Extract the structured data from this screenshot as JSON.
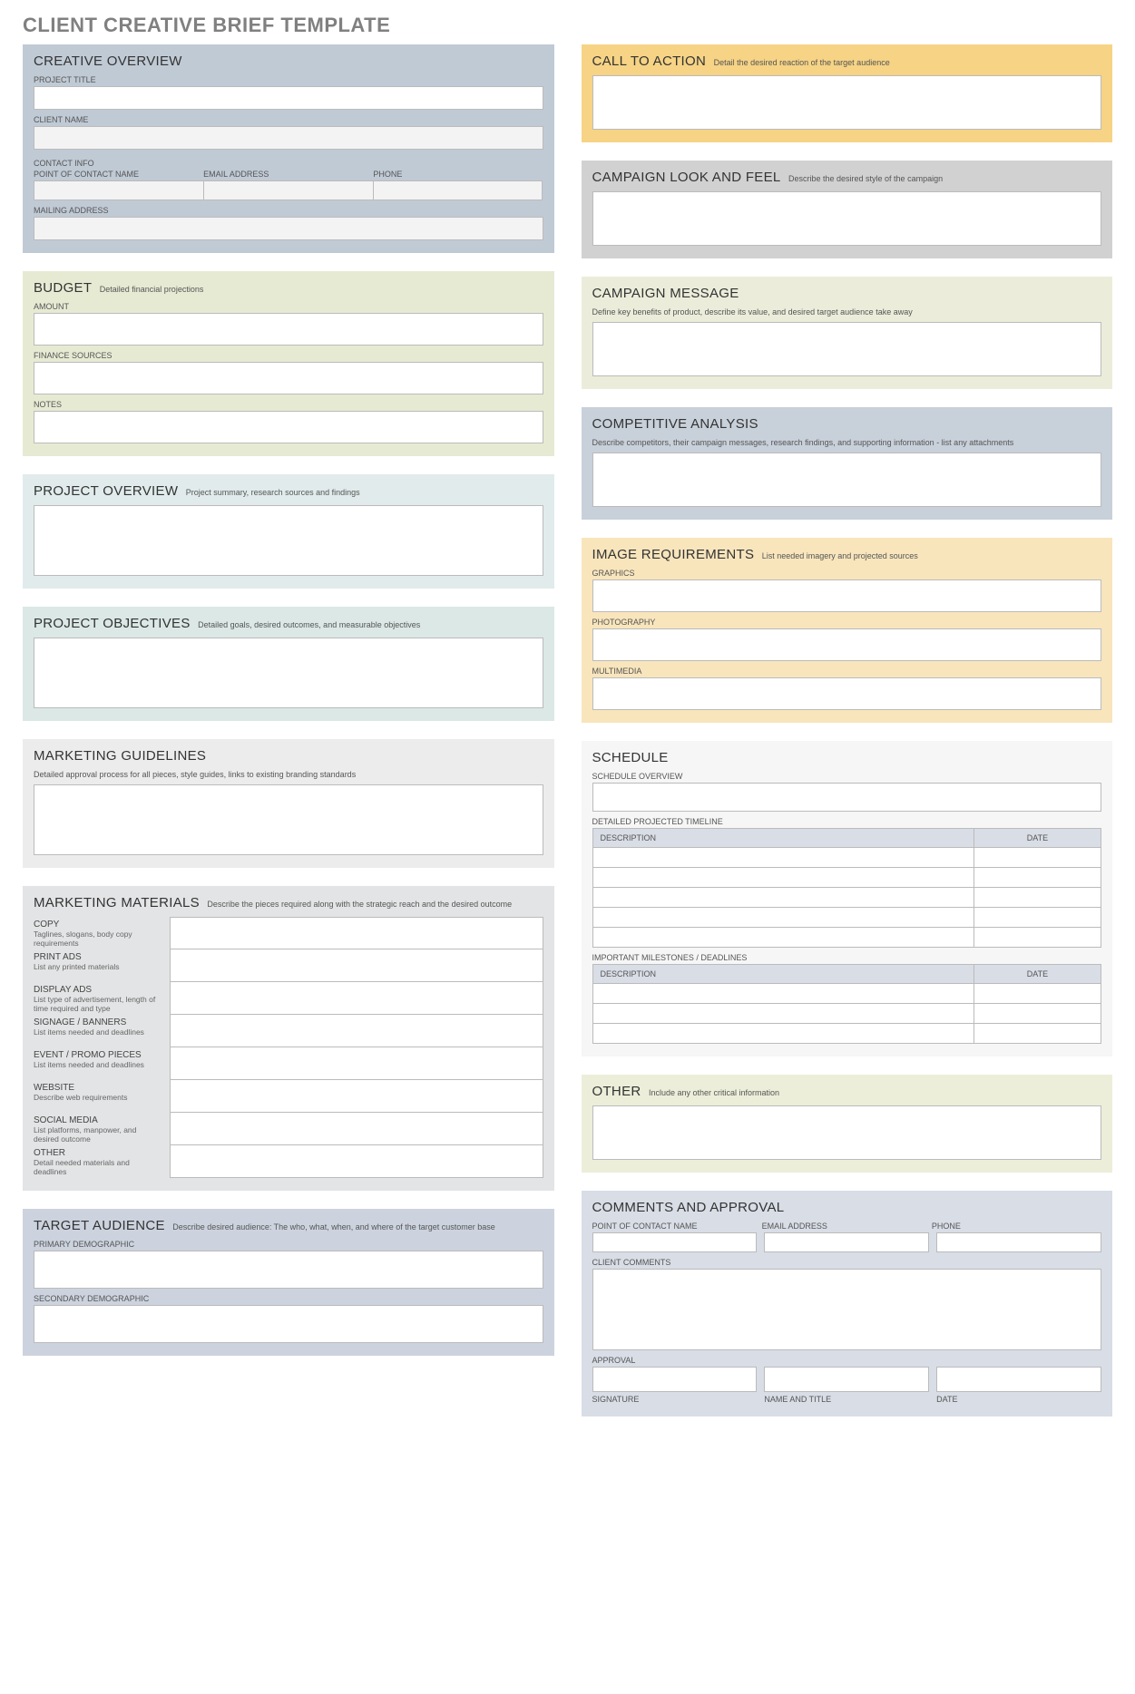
{
  "pageTitle": "CLIENT CREATIVE BRIEF TEMPLATE",
  "creativeOverview": {
    "title": "CREATIVE OVERVIEW",
    "projectTitle": "PROJECT TITLE",
    "clientName": "CLIENT NAME",
    "contactInfo": "CONTACT INFO",
    "pocName": "POINT OF CONTACT NAME",
    "email": "EMAIL ADDRESS",
    "phone": "PHONE",
    "mailing": "MAILING ADDRESS"
  },
  "budget": {
    "title": "BUDGET",
    "sub": "Detailed financial projections",
    "amount": "AMOUNT",
    "financeSources": "FINANCE SOURCES",
    "notes": "NOTES"
  },
  "projectOverview": {
    "title": "PROJECT OVERVIEW",
    "sub": "Project summary, research sources and findings"
  },
  "projectObjectives": {
    "title": "PROJECT OBJECTIVES",
    "sub": "Detailed goals, desired outcomes, and measurable objectives"
  },
  "marketingGuidelines": {
    "title": "MARKETING GUIDELINES",
    "sub": "Detailed approval process for all pieces, style guides, links to existing branding standards"
  },
  "marketingMaterials": {
    "title": "MARKETING MATERIALS",
    "sub": "Describe the pieces required along with the strategic reach and the desired outcome",
    "rows": [
      {
        "name": "COPY",
        "desc": "Taglines, slogans, body copy requirements"
      },
      {
        "name": "PRINT ADS",
        "desc": "List any printed materials"
      },
      {
        "name": "DISPLAY ADS",
        "desc": "List type of advertisement, length of time required and type"
      },
      {
        "name": "SIGNAGE / BANNERS",
        "desc": "List items needed and deadlines"
      },
      {
        "name": "EVENT / PROMO PIECES",
        "desc": "List items needed and deadlines"
      },
      {
        "name": "WEBSITE",
        "desc": "Describe web requirements"
      },
      {
        "name": "SOCIAL MEDIA",
        "desc": "List platforms, manpower, and desired outcome"
      },
      {
        "name": "OTHER",
        "desc": "Detail needed materials and deadlines"
      }
    ]
  },
  "targetAudience": {
    "title": "TARGET AUDIENCE",
    "sub": "Describe desired audience: The who, what, when, and where of the target customer base",
    "primary": "PRIMARY DEMOGRAPHIC",
    "secondary": "SECONDARY DEMOGRAPHIC"
  },
  "callToAction": {
    "title": "CALL TO ACTION",
    "sub": "Detail the desired reaction of the target audience"
  },
  "campaignLook": {
    "title": "CAMPAIGN LOOK AND FEEL",
    "sub": "Describe the desired style of the campaign"
  },
  "campaignMessage": {
    "title": "CAMPAIGN MESSAGE",
    "sub": "Define key benefits of product, describe its value, and desired target audience take away"
  },
  "competitive": {
    "title": "COMPETITIVE ANALYSIS",
    "sub": "Describe competitors, their campaign messages, research findings, and supporting information - list any attachments"
  },
  "imageReq": {
    "title": "IMAGE REQUIREMENTS",
    "sub": "List needed imagery and projected sources",
    "graphics": "GRAPHICS",
    "photography": "PHOTOGRAPHY",
    "multimedia": "MULTIMEDIA"
  },
  "schedule": {
    "title": "SCHEDULE",
    "overview": "SCHEDULE OVERVIEW",
    "timeline": "DETAILED PROJECTED TIMELINE",
    "milestones": "IMPORTANT MILESTONES / DEADLINES",
    "colDesc": "DESCRIPTION",
    "colDate": "DATE"
  },
  "other": {
    "title": "OTHER",
    "sub": "Include any other critical information"
  },
  "comments": {
    "title": "COMMENTS AND APPROVAL",
    "pocName": "POINT OF CONTACT NAME",
    "email": "EMAIL ADDRESS",
    "phone": "PHONE",
    "clientComments": "CLIENT COMMENTS",
    "approval": "APPROVAL",
    "signature": "SIGNATURE",
    "nameTitle": "NAME AND TITLE",
    "date": "DATE"
  }
}
